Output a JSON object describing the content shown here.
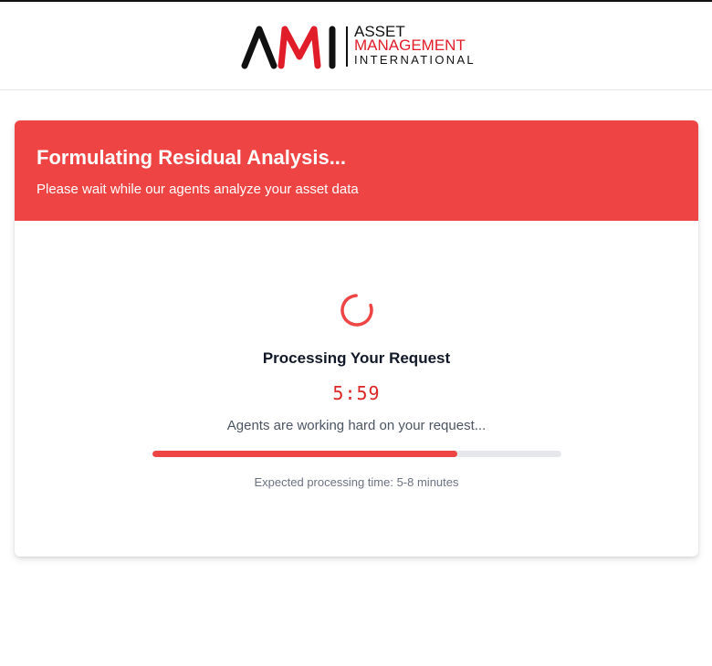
{
  "brand": {
    "logo_letters": "AMI",
    "line1": "ASSET",
    "line2": "MANAGEMENT",
    "line3": "INTERNATIONAL",
    "colors": {
      "dark": "#111111",
      "red": "#e11d2a"
    }
  },
  "card": {
    "title": "Formulating Residual Analysis...",
    "subtitle": "Please wait while our agents analyze your asset data",
    "header_color": "#ef4444"
  },
  "status": {
    "spinner_icon": "loading-spinner-icon",
    "title": "Processing Your Request",
    "timer": "5:59",
    "message": "Agents are working hard on your request...",
    "progress_fraction": 0.745,
    "expected": "Expected processing time: 5-8 minutes"
  }
}
